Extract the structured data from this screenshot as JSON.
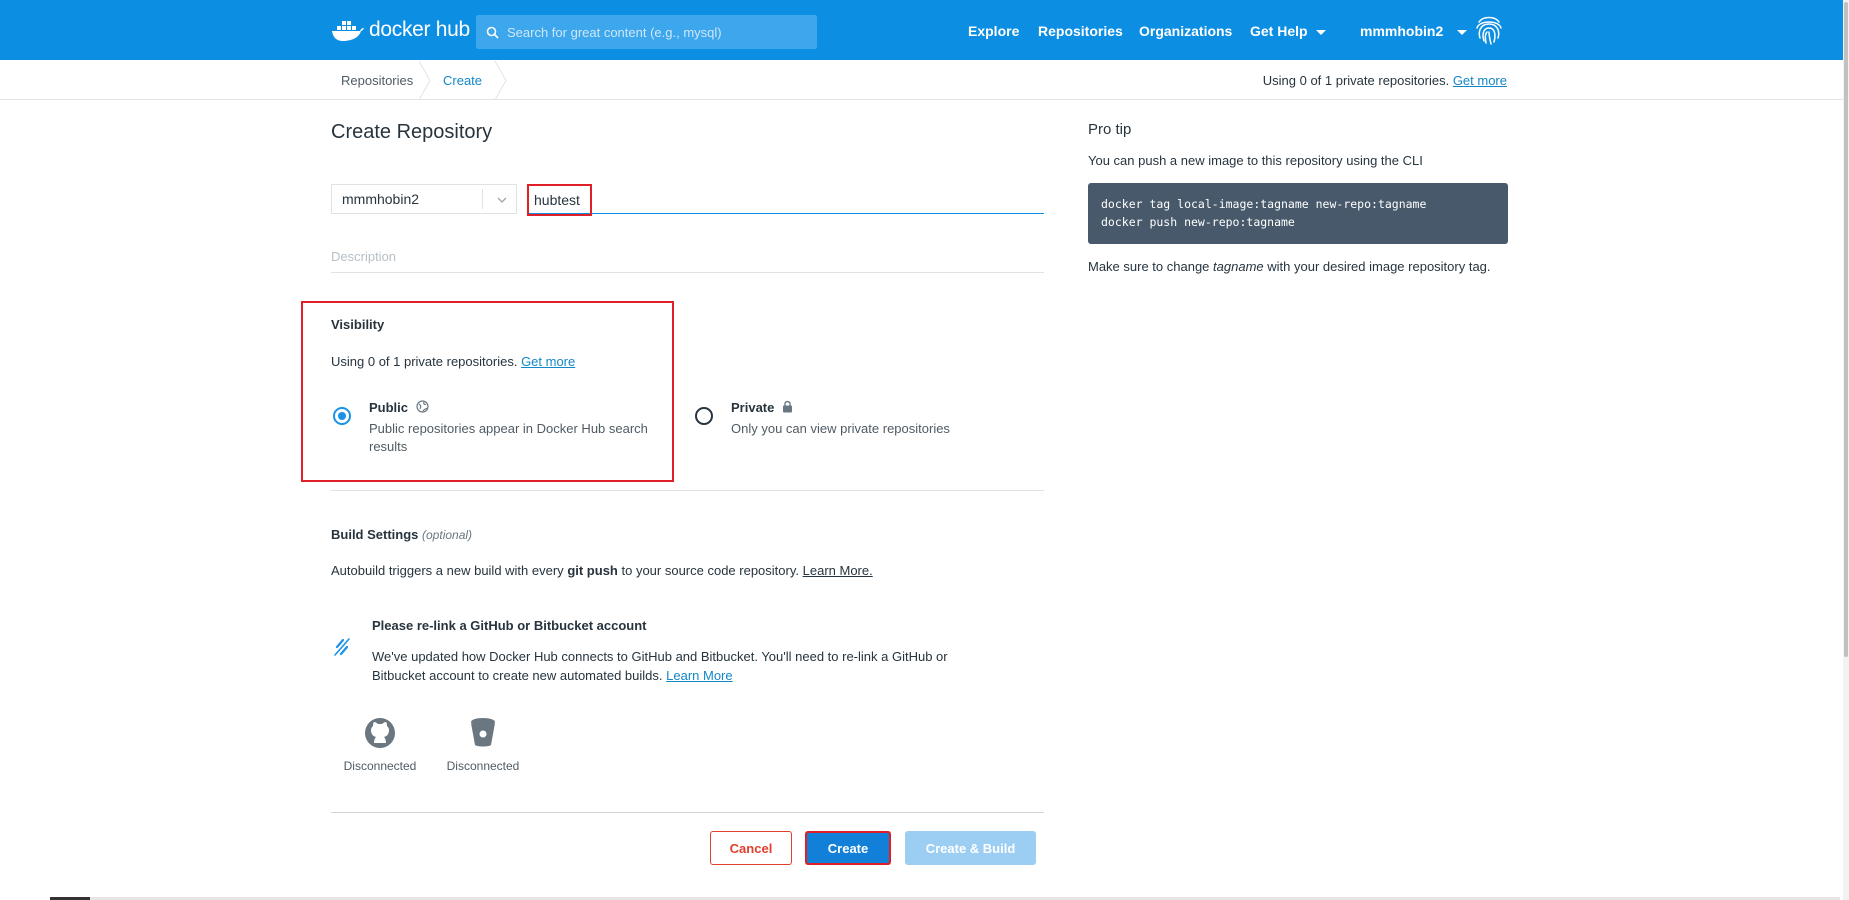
{
  "brand": {
    "logo_text": "docker hub"
  },
  "search": {
    "placeholder": "Search for great content (e.g., mysql)"
  },
  "nav": {
    "explore": "Explore",
    "repositories": "Repositories",
    "organizations": "Organizations",
    "get_help": "Get Help",
    "username": "mmmhobin2"
  },
  "breadcrumb": {
    "item1": "Repositories",
    "item2": "Create"
  },
  "quota": {
    "text": "Using 0 of 1 private repositories.",
    "link": "Get more"
  },
  "form": {
    "title": "Create Repository",
    "namespace": "mmmhobin2",
    "repo_name": "hubtest",
    "description_placeholder": "Description"
  },
  "visibility": {
    "heading": "Visibility",
    "usage_text": "Using 0 of 1 private repositories.",
    "usage_link": "Get more",
    "public_label": "Public",
    "public_desc": "Public repositories appear in Docker Hub search results",
    "private_label": "Private",
    "private_desc": "Only you can view private repositories",
    "selected": "public"
  },
  "build": {
    "heading": "Build Settings",
    "optional": "(optional)",
    "desc_pre": "Autobuild triggers a new build with every",
    "desc_bold": "git push",
    "desc_post": "to your source code repository.",
    "learn_more": "Learn More.",
    "relink_title": "Please re-link a GitHub or Bitbucket account",
    "relink_desc": "We've updated how Docker Hub connects to GitHub and Bitbucket. You'll need to re-link a GitHub or Bitbucket account to create new automated builds.",
    "relink_link": "Learn More",
    "github_status": "Disconnected",
    "bitbucket_status": "Disconnected"
  },
  "protip": {
    "heading": "Pro tip",
    "intro": "You can push a new image to this repository using the CLI",
    "code_line1": "docker tag local-image:tagname new-repo:tagname",
    "code_line2": "docker push new-repo:tagname",
    "note_pre": "Make sure to change",
    "note_em": "tagname",
    "note_post": "with your desired image repository tag."
  },
  "buttons": {
    "cancel": "Cancel",
    "create": "Create",
    "create_build": "Create & Build"
  },
  "colors": {
    "nav_bg": "#0c8ee2",
    "accent": "#1280d9",
    "highlight": "#e01f26",
    "danger": "#e0402f"
  }
}
